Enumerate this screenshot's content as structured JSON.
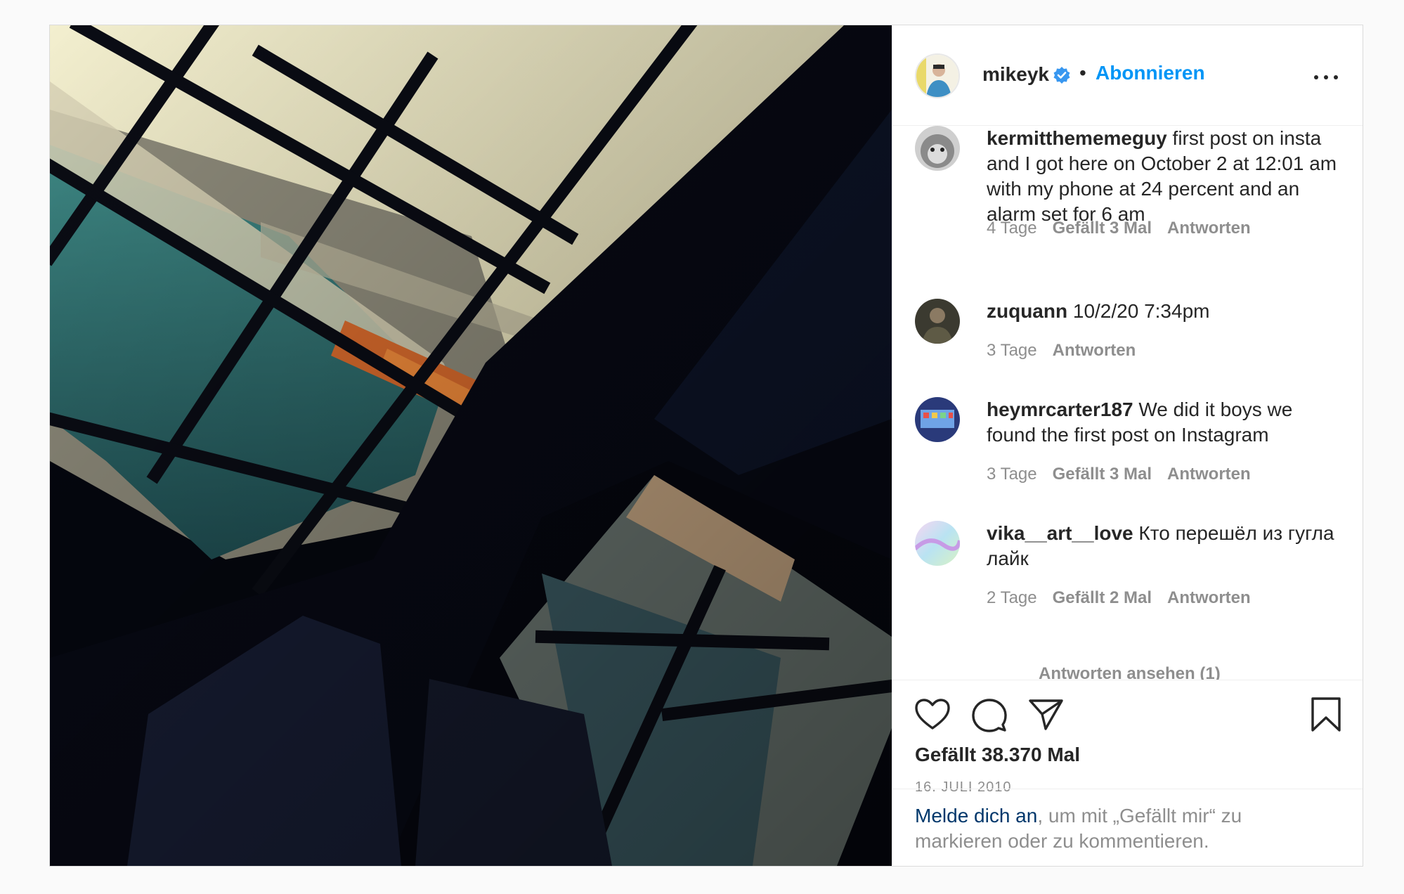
{
  "post": {
    "username": "mikeyk",
    "follow_label": "Abonnieren",
    "separator": "•",
    "photo_icon": "marina-window-photo",
    "likes_text": "Gefällt 38.370 Mal",
    "date": "16. JULI 2010"
  },
  "comments": [
    {
      "username": "kermitthememeguy",
      "text": "first post on insta and I got here on October 2 at 12:01 am with my phone at 24 percent and an alarm set for 6 am",
      "age": "4 Tage",
      "likes": "Gefällt 3 Mal",
      "reply": "Antworten"
    },
    {
      "username": "zuquann",
      "text": "10/2/20 7:34pm",
      "age": "3 Tage",
      "reply": "Antworten"
    },
    {
      "username": "heymrcarter187",
      "text": "We did it boys we found the first post on Instagram",
      "age": "3 Tage",
      "likes": "Gefällt 3 Mal",
      "reply": "Antworten"
    },
    {
      "username": "vika__art__love",
      "text": "Кто перешёл из гугла лайк",
      "age": "2 Tage",
      "likes": "Gefällt 2 Mal",
      "reply": "Antworten"
    }
  ],
  "view_replies": "Antworten ansehen (1)",
  "login": {
    "link": "Melde dich an",
    "rest": ", um mit „Gefällt mir“ zu markieren oder zu kommentieren."
  },
  "colors": {
    "accent": "#0095f6",
    "verified": "#3897f0",
    "link_dark": "#00376b",
    "muted": "#8e8e8e"
  },
  "icons": [
    "verified-badge-icon",
    "more-options-icon",
    "heart-icon",
    "comment-icon",
    "share-icon",
    "bookmark-icon"
  ]
}
